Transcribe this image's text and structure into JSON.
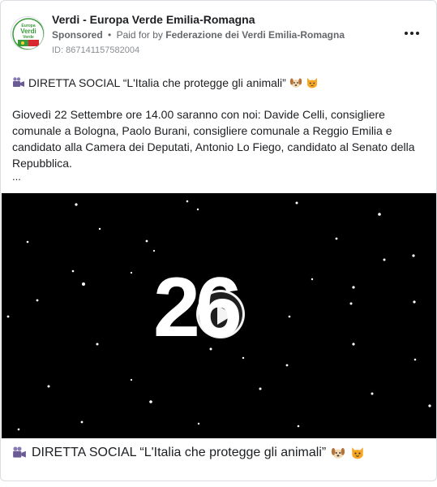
{
  "post": {
    "page_name": "Verdi - Europa Verde Emilia-Romagna",
    "sponsored_label": "Sponsored",
    "dot": "•",
    "paid_for_prefix": "Paid for by",
    "payer": "Federazione dei Verdi Emilia-Romagna",
    "ad_id": "ID: 867141157582004",
    "avatar_text": {
      "line1": "Europa",
      "line2": "Verdi",
      "line3": "Verde"
    },
    "headline": "DIRETTA SOCIAL “L'Italia che protegge gli animali”",
    "body": "Giovedì 22 Settembre ore 14.00 saranno con noi: Davide Celli, consigliere comunale a Bologna, Paolo Burani, consigliere comunale a Reggio Emilia e candidato alla Camera dei Deputati, Antonio Lo Fiego, candidato al Senato della Repubblica.",
    "ellipsis": "...",
    "video": {
      "countdown": "26"
    },
    "caption": "DIRETTA SOCIAL “L'Italia che protegge gli animali”"
  },
  "icons": {
    "video_camera": "video-camera-icon",
    "dog": "dog-face-icon",
    "cat": "cat-face-icon",
    "more": "more-options-icon",
    "play": "play-icon"
  },
  "colors": {
    "text": "#1c1e21",
    "secondary": "#65676b",
    "video_bg": "#000000",
    "logo_green": "#3a9a3a",
    "logo_red": "#d9272e"
  }
}
